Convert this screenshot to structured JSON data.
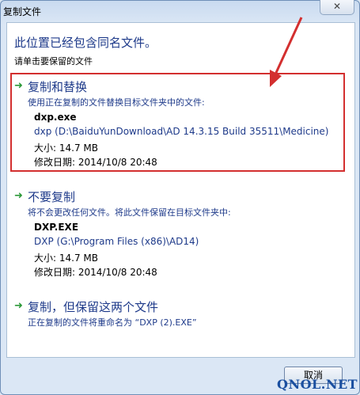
{
  "window": {
    "title": "复制文件",
    "close_label": "✕"
  },
  "dialog": {
    "heading": "此位置已经包含同名文件。",
    "subheading": "请单击要保留的文件"
  },
  "options": [
    {
      "title": "复制和替换",
      "description": "使用正在复制的文件替换目标文件夹中的文件:",
      "file_name": "dxp.exe",
      "file_path": "dxp (D:\\BaiduYunDownload\\AD 14.3.15 Build 35511\\Medicine)",
      "file_size": "大小: 14.7 MB",
      "file_date": "修改日期: 2014/10/8 20:48"
    },
    {
      "title": "不要复制",
      "description": "将不会更改任何文件。将此文件保留在目标文件夹中:",
      "file_name": "DXP.EXE",
      "file_path": "DXP (G:\\Program Files (x86)\\AD14)",
      "file_size": "大小: 14.7 MB",
      "file_date": "修改日期: 2014/10/8 20:48"
    },
    {
      "title": "复制，但保留这两个文件",
      "description": "正在复制的文件将重命名为 “DXP (2).EXE”"
    }
  ],
  "footer": {
    "cancel_label": "取消"
  },
  "watermark": "QNOL.NET",
  "colors": {
    "accent_text": "#1e3a8a",
    "arrow_green": "#2e9a3a",
    "highlight_red": "#d32f2f"
  }
}
